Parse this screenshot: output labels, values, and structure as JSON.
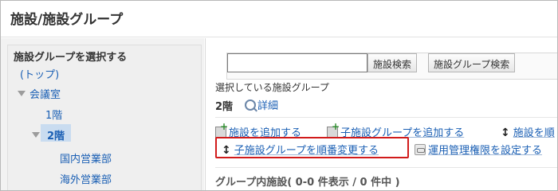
{
  "page_title": "施設/施設グループ",
  "sidebar": {
    "heading": "施設グループを選択する",
    "tree": [
      {
        "label": "(トップ)",
        "level": 0,
        "expanded": null,
        "selected": false
      },
      {
        "label": "会議室",
        "level": 0,
        "expanded": true,
        "selected": false
      },
      {
        "label": "1階",
        "level": 1,
        "expanded": null,
        "selected": false
      },
      {
        "label": "2階",
        "level": 1,
        "expanded": true,
        "selected": true
      },
      {
        "label": "国内営業部",
        "level": 2,
        "expanded": null,
        "selected": false
      },
      {
        "label": "海外営業部",
        "level": 2,
        "expanded": null,
        "selected": false
      }
    ]
  },
  "search": {
    "input_value": "",
    "facility_search_label": "施設検索",
    "group_search_label": "施設グループ検索"
  },
  "current_group": {
    "label": "選択している施設グループ",
    "name": "2階",
    "detail_link": "詳細"
  },
  "actions": {
    "add_facility": "施設を追加する",
    "add_child_group": "子施設グループを追加する",
    "reorder_facility": "施設を順",
    "reorder_child_groups": "子施設グループを順番変更する",
    "set_permissions": "運用管理権限を設定する"
  },
  "group_facilities": {
    "summary": "グループ内施設( 0-0 件表示 / 0 件中 )"
  },
  "colors": {
    "link": "#1a5fb4",
    "highlight_border": "#d11b1b",
    "selected_bg": "#c9dcf0"
  }
}
